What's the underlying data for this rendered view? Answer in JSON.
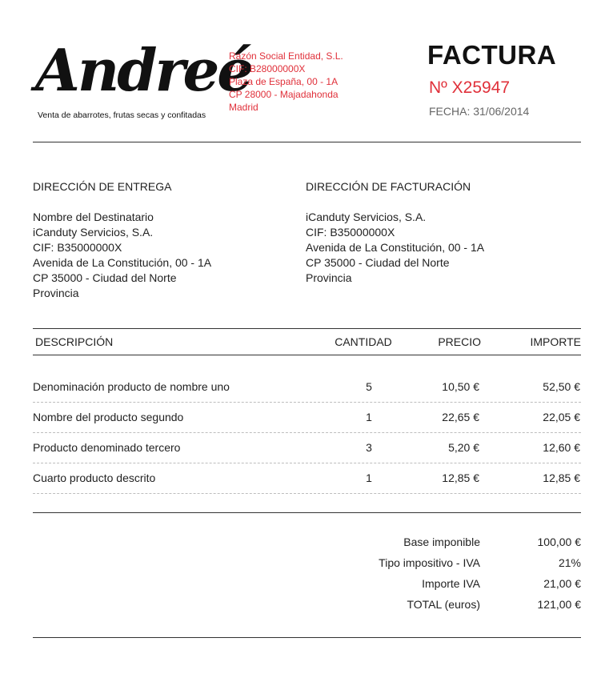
{
  "header": {
    "logo_text": "Andreé",
    "tagline": "Venta de abarrotes, frutas secas y confitadas",
    "company": {
      "name": "Razón Social Entidad, S.L.",
      "cif": "CIF: B28000000X",
      "address": "Plaza de España, 00 - 1A",
      "postal": "CP 28000 - Majadahonda",
      "city": "Madrid"
    },
    "invoice_title": "FACTURA",
    "invoice_number": "Nº X25947",
    "invoice_date": "FECHA: 31/06/2014"
  },
  "delivery": {
    "title": "DIRECCIÓN DE ENTREGA",
    "lines": [
      "Nombre del Destinatario",
      "iCanduty Servicios, S.A.",
      "CIF: B35000000X",
      "Avenida de La Constitución, 00 - 1A",
      "CP 35000 - Ciudad del Norte",
      "Provincia"
    ]
  },
  "billing": {
    "title": "DIRECCIÓN DE FACTURACIÓN",
    "lines": [
      "iCanduty Servicios, S.A.",
      "CIF: B35000000X",
      "Avenida de La Constitución, 00 - 1A",
      "CP 35000 - Ciudad del Norte",
      "Provincia"
    ]
  },
  "table": {
    "headers": {
      "description": "DESCRIPCIÓN",
      "quantity": "CANTIDAD",
      "price": "PRECIO",
      "amount": "IMPORTE"
    },
    "rows": [
      {
        "description": "Denominación producto de nombre uno",
        "quantity": "5",
        "price": "10,50 €",
        "amount": "52,50 €"
      },
      {
        "description": "Nombre del producto segundo",
        "quantity": "1",
        "price": "22,65 €",
        "amount": "22,05 €"
      },
      {
        "description": "Producto denominado tercero",
        "quantity": "3",
        "price": "5,20 €",
        "amount": "12,60 €"
      },
      {
        "description": "Cuarto producto descrito",
        "quantity": "1",
        "price": "12,85 €",
        "amount": "12,85 €"
      }
    ]
  },
  "totals": [
    {
      "label": "Base imponible",
      "value": "100,00 €"
    },
    {
      "label": "Tipo impositivo - IVA",
      "value": "21%"
    },
    {
      "label": "Importe IVA",
      "value": "21,00 €"
    },
    {
      "label": "TOTAL (euros)",
      "value": "121,00 €"
    }
  ],
  "colors": {
    "accent": "#e0303a",
    "text": "#222222",
    "muted": "#666666",
    "rule": "#333333"
  }
}
